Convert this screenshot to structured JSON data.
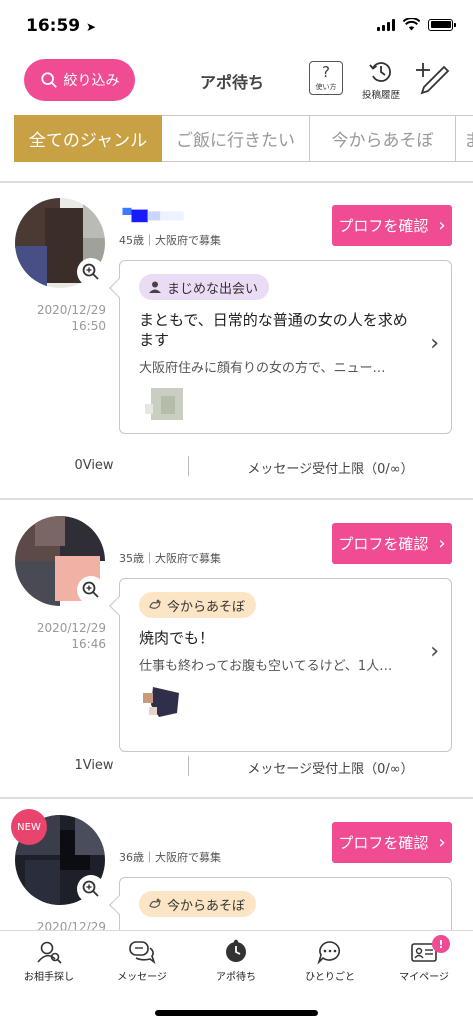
{
  "status_bar": {
    "time": "16:59"
  },
  "header": {
    "filter_label": "絞り込み",
    "title": "アポ待ち",
    "help_label": "使い方",
    "history_label": "投稿履歴"
  },
  "tabs": [
    {
      "label": "全てのジャンル",
      "active": true
    },
    {
      "label": "ご飯に行きたい",
      "active": false
    },
    {
      "label": "今からあそぼ",
      "active": false
    },
    {
      "label": "ま",
      "active": false
    }
  ],
  "posts": [
    {
      "age_location": "45歳｜大阪府で募集",
      "profile_button": "プロフを確認",
      "date": "2020/12/29",
      "time": "16:50",
      "genre": "まじめな出会い",
      "title": "まともで、日常的な普通の女の人を求めます",
      "body": "大阪府住みに顔有りの女の方で、ニュー…",
      "views": "0View",
      "message_limit": "メッセージ受付上限（0/∞）",
      "is_new": false
    },
    {
      "age_location": "35歳｜大阪府で募集",
      "profile_button": "プロフを確認",
      "date": "2020/12/29",
      "time": "16:46",
      "genre": "今からあそぼ",
      "title": "焼肉でも！",
      "body": "仕事も終わってお腹も空いてるけど、1人…",
      "views": "1View",
      "message_limit": "メッセージ受付上限（0/∞）",
      "is_new": false
    },
    {
      "age_location": "36歳｜大阪府で募集",
      "profile_button": "プロフを確認",
      "date": "2020/12/29",
      "genre": "今からあそぼ",
      "badge": "NEW",
      "is_new": true
    }
  ],
  "bottom_nav": [
    {
      "label": "お相手探し",
      "icon": "search-person-icon"
    },
    {
      "label": "メッセージ",
      "icon": "chat-bubbles-icon"
    },
    {
      "label": "アポ待ち",
      "icon": "clock-person-icon"
    },
    {
      "label": "ひとりごと",
      "icon": "speech-bubble-icon"
    },
    {
      "label": "マイページ",
      "icon": "id-card-icon",
      "badge": "!"
    }
  ],
  "colors": {
    "accent_pink": "#ef4c93",
    "tab_active_gold": "#c8a145",
    "tag_purple": "#ebdcf6",
    "tag_orange": "#fbe5c5"
  }
}
